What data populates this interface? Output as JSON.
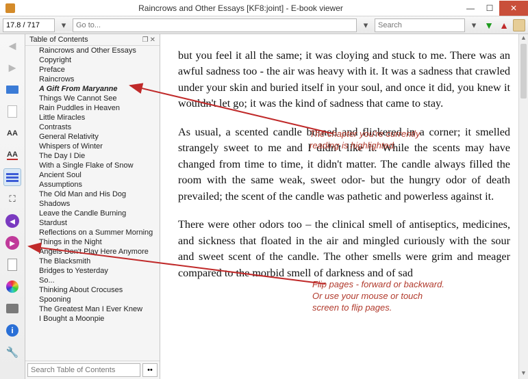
{
  "window": {
    "title": "Raincrows and Other Essays [KF8:joint] - E-book viewer"
  },
  "toolbar": {
    "page_value": "17.8 / 717",
    "go_placeholder": "Go to...",
    "search_placeholder": "Search"
  },
  "toc": {
    "header": "Table of Contents",
    "search_placeholder": "Search Table of Contents",
    "current_index": 4,
    "items": [
      "Raincrows and Other Essays",
      "Copyright",
      "Preface",
      "Raincrows",
      "A Gift From Maryanne",
      "Things We Cannot See",
      "Rain Puddles in Heaven",
      "Little Miracles",
      "Contrasts",
      "General Relativity",
      "Whispers of Winter",
      "The Day I Die",
      "With a Single Flake of Snow",
      "Ancient Soul",
      "Assumptions",
      "The Old Man and His Dog",
      "Shadows",
      "Leave the Candle Burning",
      "Stardust",
      "Reflections on a Summer Morning",
      "Things in the Night",
      "Angels Don't Play Here Anymore",
      "The Blacksmith",
      "Bridges to Yesterday",
      "So...",
      "Thinking About Crocuses",
      "Spooning",
      "The Greatest Man I Ever Knew",
      "I Bought a Moonpie"
    ]
  },
  "content": {
    "p1": "but you feel it all the same; it was cloying and stuck to me. There was an awful sadness too - the air was heavy with it. It was a sadness that crawled under your skin and buried itself in your soul, and once it did, you knew it wouldn't let go; it was the kind of sadness that came to stay.",
    "p2": "As usual, a scented candle burned and flickered in a corner; it smelled strangely sweet to me and I didn't like it. While the scents may have changed from time to time, it didn't matter. The candle always filled the room with the same weak, sweet odor- but the hungry odor of death prevailed; the scent of the candle was pathetic and powerless against it.",
    "p3": "There were other odors too – the clinical smell of antiseptics, medicines, and sickness that floated in the air and mingled curiously with the sour and sweet scent of the candle. The other smells were grim and meager compared to the morbid smell of darkness and of sad"
  },
  "annotations": {
    "a1_l1": "The chapter you're currently",
    "a1_l2": "reading is highlighted.",
    "a2_l1": "Flip pages - forward or backward.",
    "a2_l2": "Or use your mouse or touch",
    "a2_l3": "screen to flip pages."
  }
}
